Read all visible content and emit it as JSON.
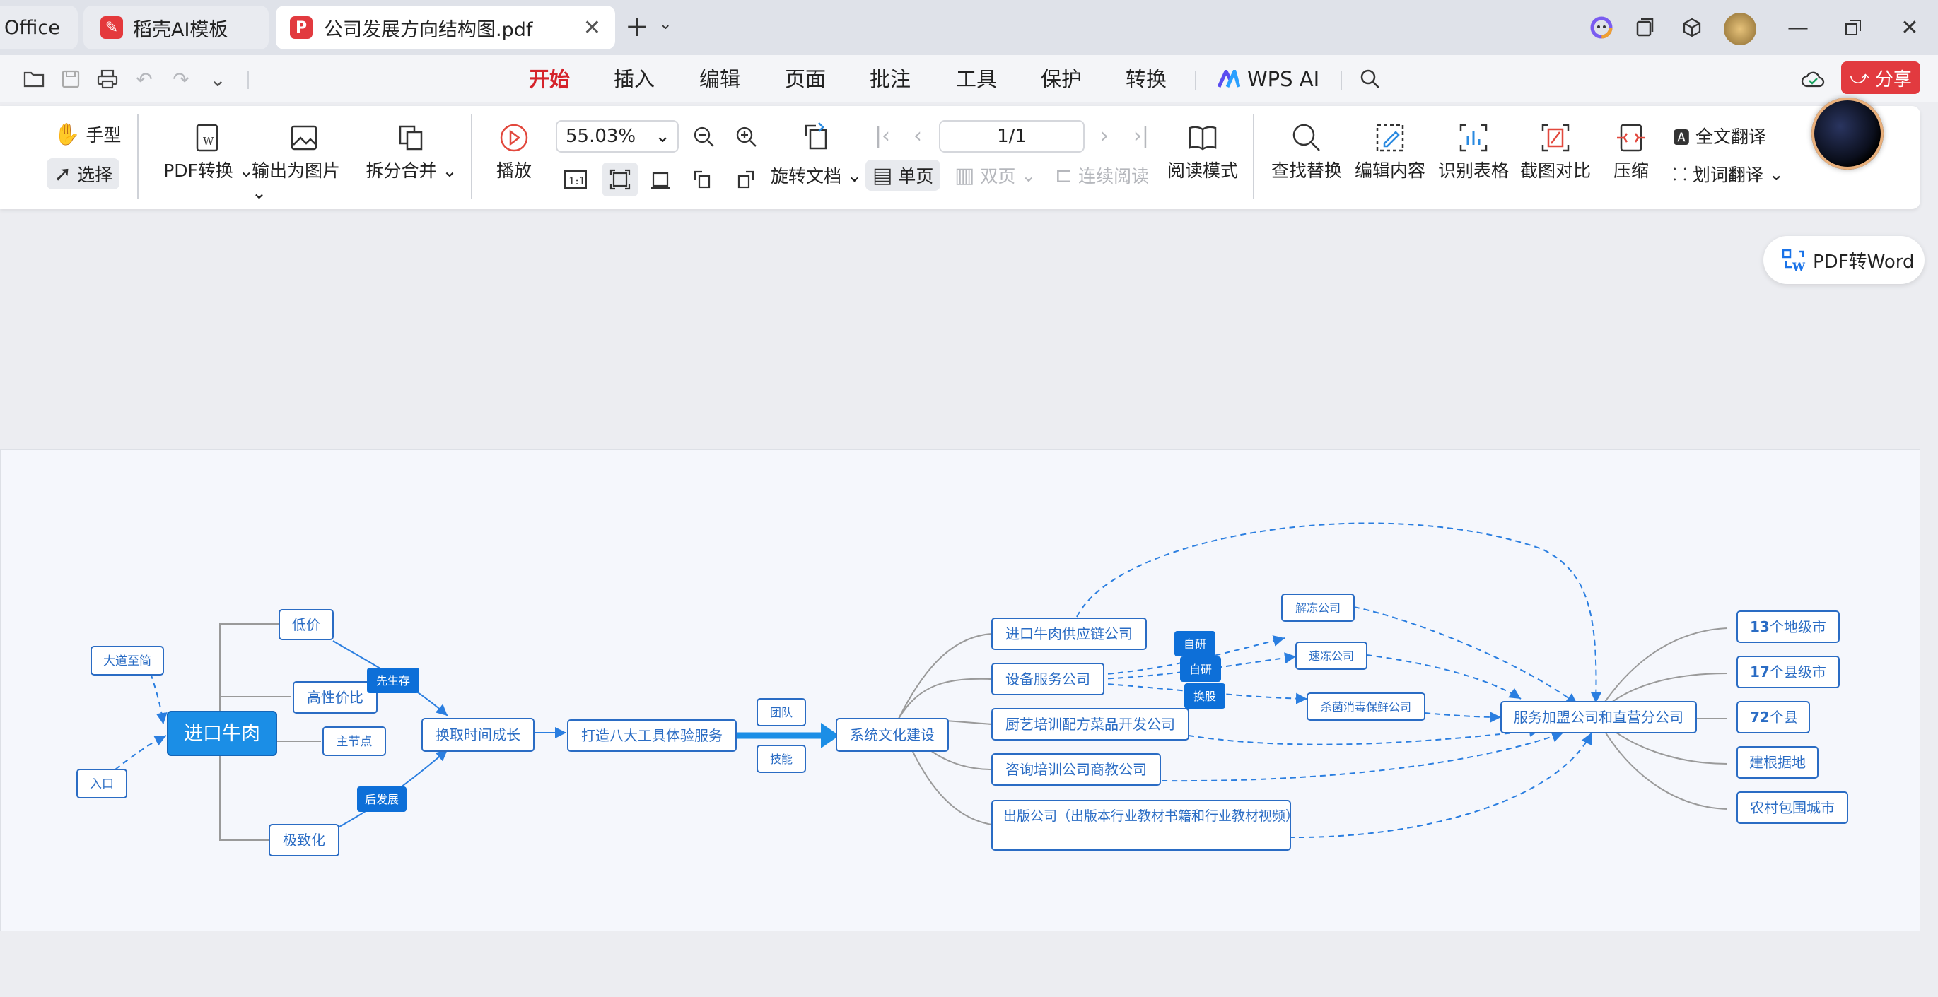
{
  "tabs": {
    "office": "Office",
    "daoke": "稻壳AI模板",
    "pdf": "公司发展方向结构图.pdf"
  },
  "menu": {
    "items": [
      "开始",
      "插入",
      "编辑",
      "页面",
      "批注",
      "工具",
      "保护",
      "转换"
    ],
    "wps_ai": "WPS AI",
    "share": "分享"
  },
  "ribbon": {
    "hand": "手型",
    "select": "选择",
    "pdf_convert": "PDF转换",
    "export_image": "输出为图片",
    "split_merge": "拆分合并",
    "play": "播放",
    "zoom": "55.03%",
    "page": "1/1",
    "rotate": "旋转文档",
    "single": "单页",
    "double": "双页",
    "continuous": "连续阅读",
    "read_mode": "阅读模式",
    "find_replace": "查找替换",
    "edit_content": "编辑内容",
    "recognize_table": "识别表格",
    "screenshot_compare": "截图对比",
    "compress": "压缩",
    "full_translate": "全文翻译",
    "word_translate": "划词翻译"
  },
  "floating": {
    "pdf2word": "PDF转Word"
  },
  "diagram": {
    "nodes": {
      "road": "大道至简",
      "entry": "入口",
      "root": "进口牛肉",
      "low_price": "低价",
      "cost_perf": "高性价比",
      "main_node": "主节点",
      "extreme": "极致化",
      "survive": "先生存",
      "develop": "后发展",
      "time_growth": "换取时间成长",
      "eight_tools": "打造八大工具体验服务",
      "team": "团队",
      "skill": "技能",
      "culture": "系统文化建设",
      "supply": "进口牛肉供应链公司",
      "equip": "设备服务公司",
      "chef": "厨艺培训配方菜品开发公司",
      "consult": "咨询培训公司商教公司",
      "publish": "出版公司（出版本行业教材书籍和行业教材视频）",
      "self1": "自研",
      "self2": "自研",
      "swap": "换股",
      "thaw": "解冻公司",
      "freeze": "速冻公司",
      "sterile": "杀菌消毒保鲜公司",
      "franchise": "服务加盟公司和直营分公司",
      "c13_num": "13",
      "c13_txt": "个地级市",
      "c17_num": "17",
      "c17_txt": "个县级市",
      "c72_num": "72",
      "c72_txt": "个县",
      "base": "建根据地",
      "rural": "农村包围城市"
    }
  },
  "colors": {
    "accent": "#d5232b",
    "node_blue": "#1b8ee6",
    "badge_blue": "#0d6fd8",
    "border_blue": "#2a6cc4"
  }
}
